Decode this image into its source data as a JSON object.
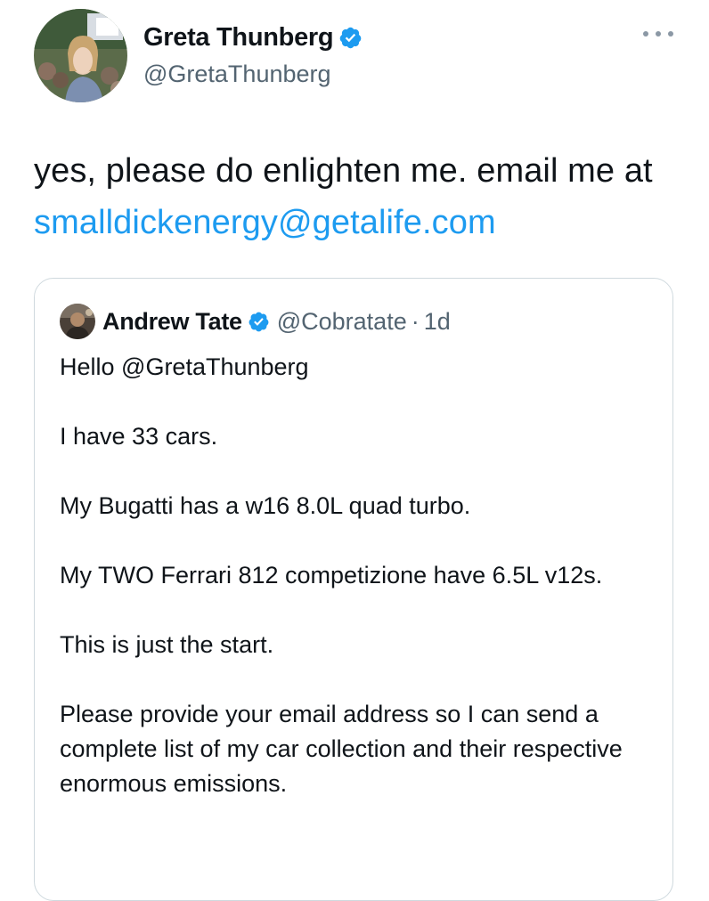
{
  "tweet": {
    "author_name": "Greta Thunberg",
    "author_handle": "@GretaThunberg",
    "verified_icon": "verified-badge-icon",
    "more_icon": "more-options-icon",
    "text_prefix": "yes, please do enlighten me. email me at ",
    "text_link": "smalldickenergy@getalife.com"
  },
  "quote": {
    "author_name": "Andrew Tate",
    "author_handle": "@Cobratate",
    "separator": "·",
    "timestamp": "1d",
    "paragraphs": [
      "Hello @GretaThunberg",
      "I have 33 cars.",
      "My Bugatti has a w16 8.0L quad turbo.",
      "My TWO Ferrari 812 competizione have 6.5L v12s.",
      "This is just the start.",
      "Please provide your email address so I can send a complete list of my car collection and their respective enormous emissions."
    ]
  },
  "colors": {
    "link": "#1d9bf0",
    "secondary_text": "#536471",
    "border": "#cfd9de",
    "verified": "#1d9bf0"
  }
}
